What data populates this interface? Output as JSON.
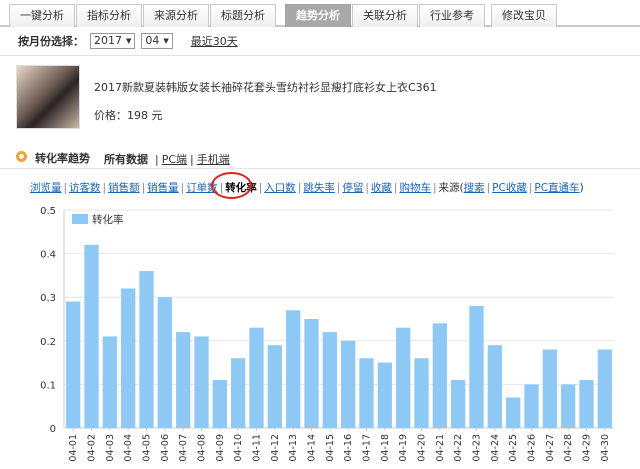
{
  "tabs": [
    {
      "label": "一键分析",
      "active": false
    },
    {
      "label": "指标分析",
      "active": false
    },
    {
      "label": "来源分析",
      "active": false
    },
    {
      "label": "标题分析",
      "active": false
    },
    {
      "label": "趋势分析",
      "active": true
    },
    {
      "label": "关联分析",
      "active": false
    },
    {
      "label": "行业参考",
      "active": false
    },
    {
      "label": "修改宝贝",
      "active": false
    }
  ],
  "month_selector": {
    "label": "按月份选择：",
    "year": "2017",
    "month": "04",
    "recent_link": "最近30天"
  },
  "product": {
    "title": "2017新款夏装韩版女装长袖碎花套头雪纺衬衫显瘦打底衫女上衣C361",
    "price": "价格：198 元"
  },
  "trend": {
    "title": "转化率趋势",
    "filters": [
      "所有数据",
      "PC端",
      "手机端"
    ]
  },
  "metrics": {
    "items": [
      "浏览量",
      "访客数",
      "销售额",
      "销售量",
      "订单数",
      "转化率",
      "入口数",
      "跳失率",
      "停留",
      "收藏",
      "购物车"
    ],
    "selected": "转化率",
    "source_label": "来源(",
    "sources": [
      "搜索",
      "PC收藏",
      "PC直通车"
    ],
    "source_end": ")"
  },
  "colors": {
    "bar": "#8ec9f5",
    "active_tab": "#a8a8a8",
    "highlight_circle": "#dd2222",
    "link": "#1a66b3",
    "trend_icon": "#f0a23c"
  },
  "chart_data": {
    "type": "bar",
    "categories": [
      "04-01",
      "04-02",
      "04-03",
      "04-04",
      "04-05",
      "04-06",
      "04-07",
      "04-08",
      "04-09",
      "04-10",
      "04-11",
      "04-12",
      "04-13",
      "04-14",
      "04-15",
      "04-16",
      "04-17",
      "04-18",
      "04-19",
      "04-20",
      "04-21",
      "04-22",
      "04-23",
      "04-24",
      "04-25",
      "04-26",
      "04-27",
      "04-28",
      "04-29",
      "04-30"
    ],
    "series": [
      {
        "name": "转化率",
        "values": [
          0.29,
          0.42,
          0.21,
          0.32,
          0.36,
          0.3,
          0.22,
          0.21,
          0.11,
          0.16,
          0.23,
          0.19,
          0.27,
          0.25,
          0.22,
          0.2,
          0.16,
          0.15,
          0.23,
          0.16,
          0.24,
          0.11,
          0.28,
          0.19,
          0.07,
          0.1,
          0.18,
          0.1,
          0.11,
          0.18
        ]
      }
    ],
    "ylim": [
      0,
      0.5
    ],
    "yticks": [
      "0",
      "0.1",
      "0.2",
      "0.3",
      "0.4",
      "0.5"
    ],
    "grid": true,
    "legend": "top-left"
  }
}
